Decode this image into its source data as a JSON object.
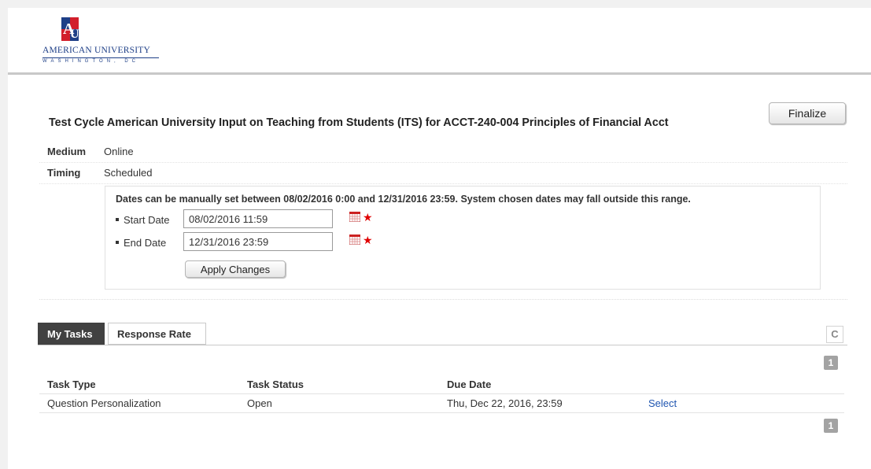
{
  "header": {
    "brand_name": "AMERICAN UNIVERSITY",
    "brand_city": "WASHINGTON, DC",
    "logo_colors": {
      "red": "#d21f2b",
      "blue": "#1e3f87"
    }
  },
  "page": {
    "title": "Test Cycle American University Input on Teaching from Students (ITS) for ACCT-240-004 Principles of Financial Acct",
    "finalize_label": "Finalize"
  },
  "fields": {
    "medium_label": "Medium",
    "medium_value": "Online",
    "timing_label": "Timing",
    "timing_value": "Scheduled"
  },
  "dates": {
    "note": "Dates can be manually set between 08/02/2016 0:00 and 12/31/2016 23:59. System chosen dates may fall outside this range.",
    "start_label": "Start Date",
    "start_value": "08/02/2016 11:59",
    "end_label": "End Date",
    "end_value": "12/31/2016 23:59",
    "required_mark": "★",
    "apply_label": "Apply Changes"
  },
  "tabs": [
    {
      "label": "My Tasks",
      "active": true
    },
    {
      "label": "Response Rate",
      "active": false
    }
  ],
  "refresh_icon": "C",
  "pager": {
    "top_page": "1",
    "bottom_page": "1"
  },
  "tasks": {
    "columns": [
      "Task Type",
      "Task Status",
      "Due Date"
    ],
    "rows": [
      {
        "type": "Question Personalization",
        "status": "Open",
        "due": "Thu, Dec 22, 2016, 23:59",
        "action": "Select"
      }
    ]
  },
  "colors": {
    "link": "#1f55b0",
    "required": "#e00000",
    "active_tab": "#414141"
  }
}
